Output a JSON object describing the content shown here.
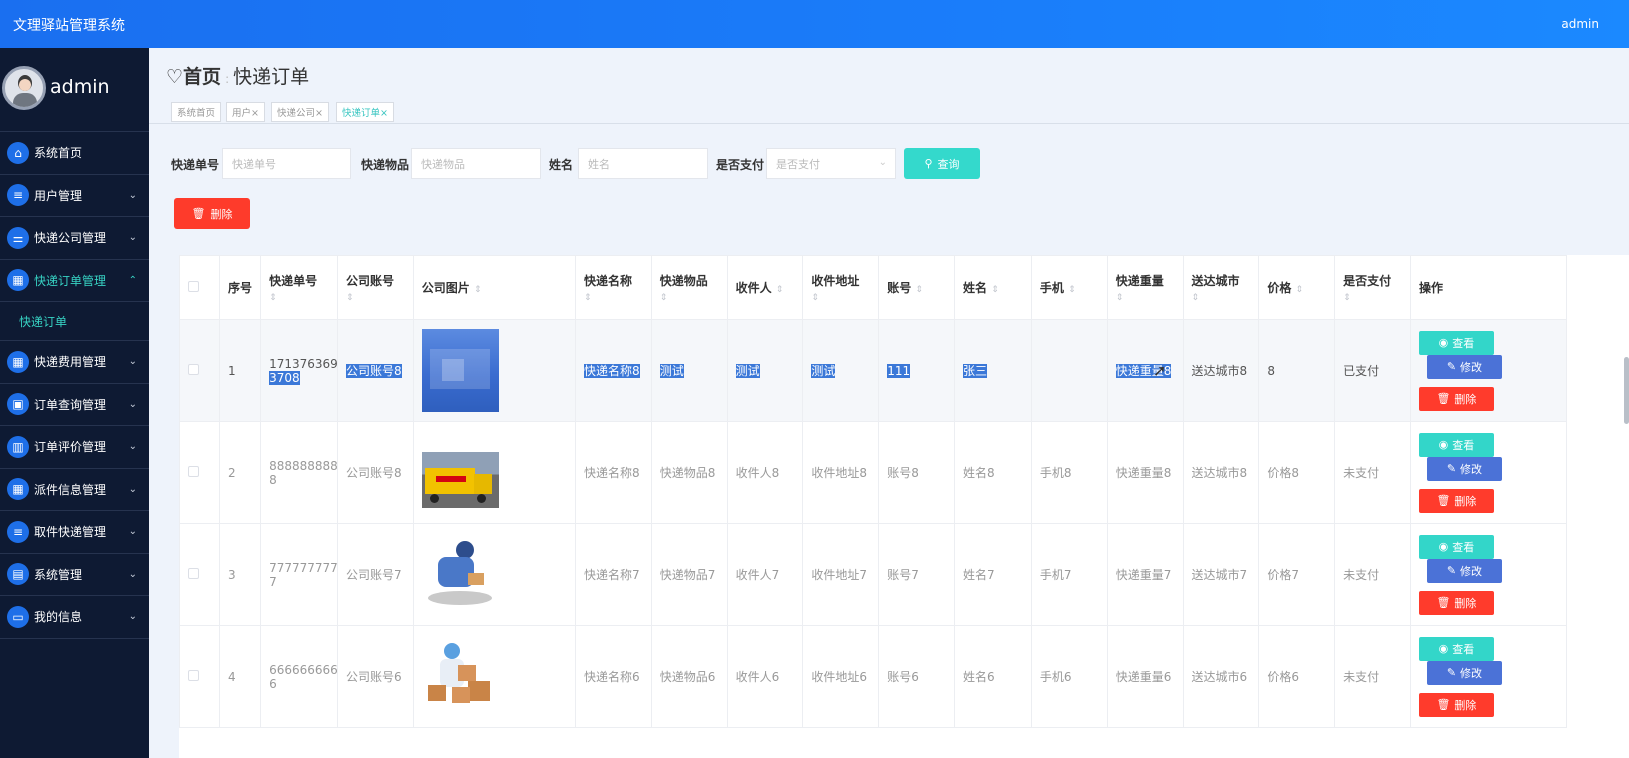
{
  "app": {
    "title": "文理驿站管理系统",
    "user": "admin"
  },
  "sidebar": {
    "profile_name": "admin",
    "items": [
      {
        "label": "系统首页",
        "icon": "home-icon",
        "glyph": "⌂",
        "chev": ""
      },
      {
        "label": "用户管理",
        "icon": "list-icon",
        "glyph": "≡",
        "chev": "⌄"
      },
      {
        "label": "快递公司管理",
        "icon": "sliders-icon",
        "glyph": "⚌",
        "chev": "⌄"
      },
      {
        "label": "快递订单管理",
        "icon": "grid-icon",
        "glyph": "▦",
        "chev": "⌃"
      },
      {
        "label": "快递费用管理",
        "icon": "grid-icon",
        "glyph": "▦",
        "chev": "⌄"
      },
      {
        "label": "订单查询管理",
        "icon": "briefcase-icon",
        "glyph": "▣",
        "chev": "⌄"
      },
      {
        "label": "订单评价管理",
        "icon": "book-icon",
        "glyph": "▥",
        "chev": "⌄"
      },
      {
        "label": "派件信息管理",
        "icon": "grid-icon",
        "glyph": "▦",
        "chev": "⌄"
      },
      {
        "label": "取件快递管理",
        "icon": "list-icon",
        "glyph": "≡",
        "chev": "⌄"
      },
      {
        "label": "系统管理",
        "icon": "clipboard-icon",
        "glyph": "▤",
        "chev": "⌄"
      },
      {
        "label": "我的信息",
        "icon": "card-icon",
        "glyph": "▭",
        "chev": "⌄"
      }
    ],
    "submenu_label": "快递订单"
  },
  "breadcrumb": {
    "home": "首页",
    "sep": ":",
    "current": "快递订单"
  },
  "tabs": [
    "系统首页",
    "用户×",
    "快递公司×",
    "快递订单×"
  ],
  "search": {
    "f1_label": "快递单号",
    "f1_placeholder": "快递单号",
    "f2_label": "快递物品",
    "f2_placeholder": "快递物品",
    "f3_label": "姓名",
    "f3_placeholder": "姓名",
    "f4_label": "是否支付",
    "f4_placeholder": "是否支付",
    "button": "查询"
  },
  "delete_button": "删除",
  "table": {
    "headers": [
      "序号",
      "快递单号",
      "公司账号",
      "公司图片",
      "快递名称",
      "快递物品",
      "收件人",
      "收件地址",
      "账号",
      "姓名",
      "手机",
      "快递重量",
      "送达城市",
      "价格",
      "是否支付",
      "操作"
    ],
    "sort_mark": "⇕",
    "btn_view": "查看",
    "btn_edit": "修改",
    "btn_delete": "删除",
    "rows": [
      {
        "idx": "1",
        "no_a": "171376369",
        "no_b": "3708",
        "company": "公司账号8",
        "name": "快递名称8",
        "item": "测试",
        "recv": "测试",
        "addr": "测试",
        "acct": "111",
        "person": "张三",
        "phone": "",
        "weight": "快递重量8",
        "city": "送达城市8",
        "price": "8",
        "paid": "已支付"
      },
      {
        "idx": "2",
        "no_a": "888888888",
        "no_b": "8",
        "company": "公司账号8",
        "name": "快递名称8",
        "item": "快递物品8",
        "recv": "收件人8",
        "addr": "收件地址8",
        "acct": "账号8",
        "person": "姓名8",
        "phone": "手机8",
        "weight": "快递重量8",
        "city": "送达城市8",
        "price": "价格8",
        "paid": "未支付"
      },
      {
        "idx": "3",
        "no_a": "777777777",
        "no_b": "7",
        "company": "公司账号7",
        "name": "快递名称7",
        "item": "快递物品7",
        "recv": "收件人7",
        "addr": "收件地址7",
        "acct": "账号7",
        "person": "姓名7",
        "phone": "手机7",
        "weight": "快递重量7",
        "city": "送达城市7",
        "price": "价格7",
        "paid": "未支付"
      },
      {
        "idx": "4",
        "no_a": "666666666",
        "no_b": "6",
        "company": "公司账号6",
        "name": "快递名称6",
        "item": "快递物品6",
        "recv": "收件人6",
        "addr": "收件地址6",
        "acct": "账号6",
        "person": "姓名6",
        "phone": "手机6",
        "weight": "快递重量6",
        "city": "送达城市6",
        "price": "价格6",
        "paid": "未支付"
      }
    ]
  },
  "colors": {
    "accent": "#33d6c9",
    "danger": "#ff3b2c",
    "primary": "#4b72d7",
    "sidebar_bg": "#0e1a33",
    "topbar": "#1a7dfa"
  }
}
